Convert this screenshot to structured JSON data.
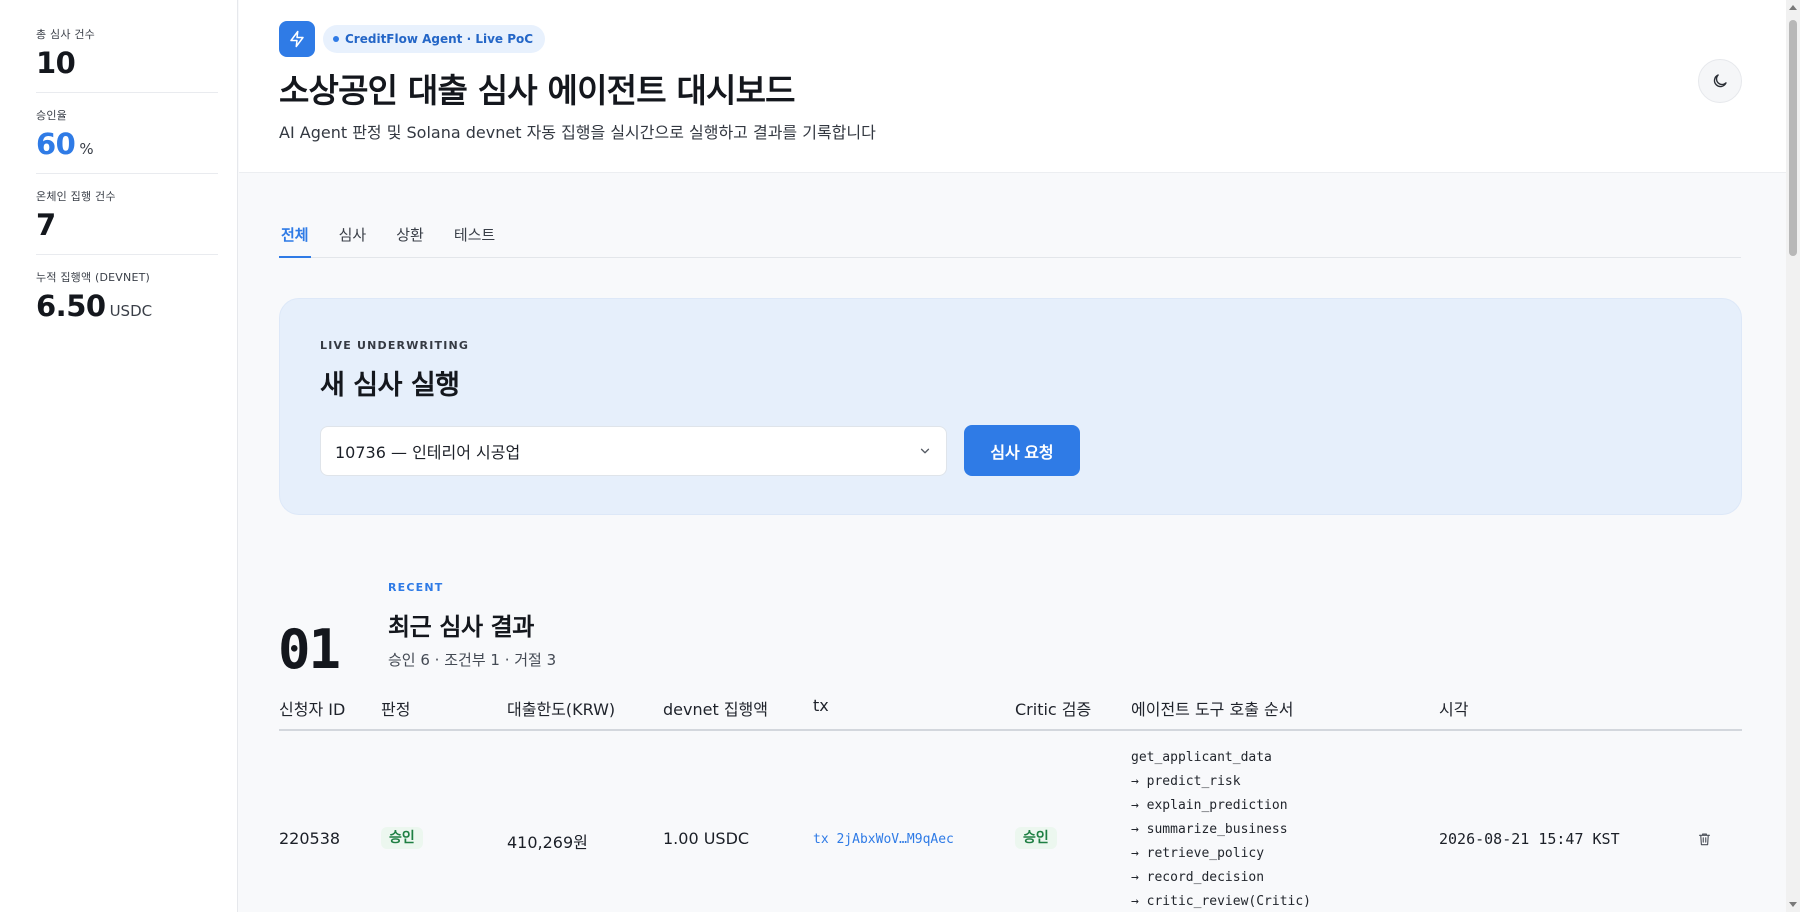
{
  "sidebar": {
    "stats": [
      {
        "label": "총 심사 건수",
        "value": "10",
        "unit": ""
      },
      {
        "label": "승인율",
        "value": "60",
        "unit": "%"
      },
      {
        "label": "온체인 집행 건수",
        "value": "7",
        "unit": ""
      },
      {
        "label": "누적 집행액 (DEVNET)",
        "value": "6.50",
        "unit": "USDC"
      }
    ]
  },
  "header": {
    "brand_pill": "CreditFlow Agent · Live PoC",
    "title": "소상공인 대출 심사 에이전트 대시보드",
    "subtitle": "AI Agent 판정 및 Solana devnet 자동 집행을 실시간으로 실행하고 결과를 기록합니다"
  },
  "tabs": [
    {
      "label": "전체",
      "active": true
    },
    {
      "label": "심사",
      "active": false
    },
    {
      "label": "상환",
      "active": false
    },
    {
      "label": "테스트",
      "active": false
    }
  ],
  "underwriting": {
    "eyebrow": "LIVE UNDERWRITING",
    "title": "새 심사 실행",
    "selected_applicant": "10736 — 인테리어 시공업",
    "submit_label": "심사 요청"
  },
  "recent": {
    "number": "01",
    "eyebrow": "RECENT",
    "title": "최근 심사 결과",
    "summary": "승인 6 · 조건부 1 · 거절 3",
    "columns": [
      "신청자 ID",
      "판정",
      "대출한도(KRW)",
      "devnet 집행액",
      "tx",
      "Critic 검증",
      "에이전트 도구 호출 순서",
      "시각"
    ],
    "rows": [
      {
        "applicant_id": "220538",
        "decision": "승인",
        "limit": "410,269원",
        "amount": "1.00 USDC",
        "tx": "tx 2jAbxWoV…M9qAec",
        "critic": "승인",
        "tools": "get_applicant_data\n→ predict_risk\n→ explain_prediction\n→ summarize_business\n→ retrieve_policy\n→ record_decision\n→ critic_review(Critic)",
        "time": "2026-08-21 15:47 KST"
      }
    ]
  },
  "colors": {
    "accent": "#2f7be6",
    "approve_green": "#1e7f43",
    "card_bg": "#e6effb"
  },
  "icons": {
    "brand": "lightning-icon",
    "theme": "moon-icon",
    "select": "chevron-down-icon",
    "row_action": "trash-icon"
  }
}
